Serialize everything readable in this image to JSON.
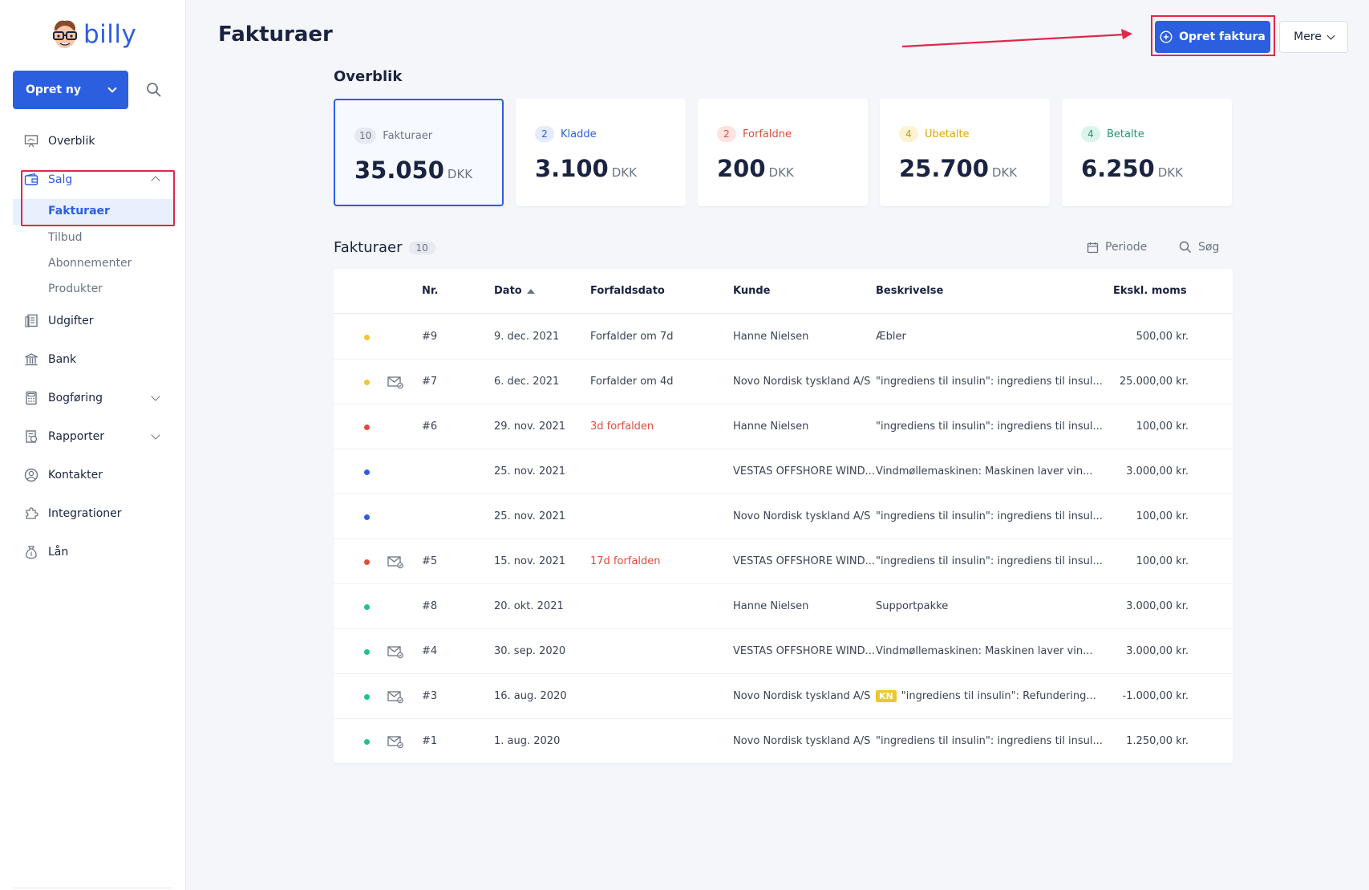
{
  "brand": {
    "name": "billy"
  },
  "sidebar": {
    "create_label": "Opret ny",
    "items": [
      {
        "label": "Overblik",
        "icon": "presentation-icon"
      },
      {
        "label": "Salg",
        "icon": "wallet-icon"
      },
      {
        "label": "Udgifter",
        "icon": "receipt-icon"
      },
      {
        "label": "Bank",
        "icon": "bank-icon"
      },
      {
        "label": "Bogføring",
        "icon": "calculator-icon"
      },
      {
        "label": "Rapporter",
        "icon": "report-icon"
      },
      {
        "label": "Kontakter",
        "icon": "user-circle-icon"
      },
      {
        "label": "Integrationer",
        "icon": "puzzle-icon"
      },
      {
        "label": "Lån",
        "icon": "money-bag-icon"
      }
    ],
    "sales_sub": [
      "Fakturaer",
      "Tilbud",
      "Abonnementer",
      "Produkter"
    ]
  },
  "header": {
    "title": "Fakturaer",
    "primary_label": "Opret faktura",
    "more_label": "Mere"
  },
  "overview": {
    "title": "Overblik",
    "cards": [
      {
        "count": "10",
        "label": "Fakturaer",
        "amount": "35.050",
        "currency": "DKK",
        "badge_bg": "#e6e9ef",
        "badge_fg": "#6b7383",
        "label_color": "#6b7383"
      },
      {
        "count": "2",
        "label": "Kladde",
        "amount": "3.100",
        "currency": "DKK",
        "badge_bg": "#e3ebfc",
        "badge_fg": "#2b5fe0",
        "label_color": "#2b5fe0"
      },
      {
        "count": "2",
        "label": "Forfaldne",
        "amount": "200",
        "currency": "DKK",
        "badge_bg": "#fde4e1",
        "badge_fg": "#e24b3b",
        "label_color": "#e24b3b"
      },
      {
        "count": "4",
        "label": "Ubetalte",
        "amount": "25.700",
        "currency": "DKK",
        "badge_bg": "#fdf3d0",
        "badge_fg": "#c9980a",
        "label_color": "#e0a800"
      },
      {
        "count": "4",
        "label": "Betalte",
        "amount": "6.250",
        "currency": "DKK",
        "badge_bg": "#dcf5ea",
        "badge_fg": "#1e9b6a",
        "label_color": "#1e9b6a"
      }
    ]
  },
  "invoices": {
    "title": "Fakturaer",
    "count": "10",
    "period_label": "Periode",
    "search_label": "Søg",
    "columns": {
      "nr": "Nr.",
      "date": "Dato",
      "due": "Forfaldsdato",
      "customer": "Kunde",
      "description": "Beskrivelse",
      "amount": "Ekskl. moms"
    },
    "rows": [
      {
        "status_color": "#f4c430",
        "mail": false,
        "nr": "#9",
        "date": "9. dec. 2021",
        "due": "Forfalder om 7d",
        "due_overdue": false,
        "customer": "Hanne Nielsen",
        "kn": "",
        "description": "Æbler",
        "amount": "500,00 kr."
      },
      {
        "status_color": "#f4c430",
        "mail": true,
        "nr": "#7",
        "date": "6. dec. 2021",
        "due": "Forfalder om 4d",
        "due_overdue": false,
        "customer": "Novo Nordisk tyskland A/S",
        "kn": "",
        "description": "\"ingrediens til insulin\": ingrediens til insul...",
        "amount": "25.000,00 kr."
      },
      {
        "status_color": "#e24b3b",
        "mail": false,
        "nr": "#6",
        "date": "29. nov. 2021",
        "due": "3d forfalden",
        "due_overdue": true,
        "customer": "Hanne Nielsen",
        "kn": "",
        "description": "\"ingrediens til insulin\": ingrediens til insul...",
        "amount": "100,00 kr."
      },
      {
        "status_color": "#2b5fe0",
        "mail": false,
        "nr": "",
        "date": "25. nov. 2021",
        "due": "",
        "due_overdue": false,
        "customer": "VESTAS OFFSHORE WIND...",
        "kn": "",
        "description": "Vindmøllemaskinen: Maskinen laver vin...",
        "amount": "3.000,00 kr."
      },
      {
        "status_color": "#2b5fe0",
        "mail": false,
        "nr": "",
        "date": "25. nov. 2021",
        "due": "",
        "due_overdue": false,
        "customer": "Novo Nordisk tyskland A/S",
        "kn": "",
        "description": "\"ingrediens til insulin\": ingrediens til insul...",
        "amount": "100,00 kr."
      },
      {
        "status_color": "#e24b3b",
        "mail": true,
        "nr": "#5",
        "date": "15. nov. 2021",
        "due": "17d forfalden",
        "due_overdue": true,
        "customer": "VESTAS OFFSHORE WIND...",
        "kn": "",
        "description": "\"ingrediens til insulin\": ingrediens til insul...",
        "amount": "100,00 kr."
      },
      {
        "status_color": "#1ec28b",
        "mail": false,
        "nr": "#8",
        "date": "20. okt. 2021",
        "due": "",
        "due_overdue": false,
        "customer": "Hanne Nielsen",
        "kn": "",
        "description": "Supportpakke",
        "amount": "3.000,00 kr."
      },
      {
        "status_color": "#1ec28b",
        "mail": true,
        "nr": "#4",
        "date": "30. sep. 2020",
        "due": "",
        "due_overdue": false,
        "customer": "VESTAS OFFSHORE WIND...",
        "kn": "",
        "description": "Vindmøllemaskinen: Maskinen laver vin...",
        "amount": "3.000,00 kr."
      },
      {
        "status_color": "#1ec28b",
        "mail": true,
        "nr": "#3",
        "date": "16. aug. 2020",
        "due": "",
        "due_overdue": false,
        "customer": "Novo Nordisk tyskland A/S",
        "kn": "KN",
        "description": "\"ingrediens til insulin\": Refundering...",
        "amount": "-1.000,00 kr."
      },
      {
        "status_color": "#1ec28b",
        "mail": true,
        "nr": "#1",
        "date": "1. aug. 2020",
        "due": "",
        "due_overdue": false,
        "customer": "Novo Nordisk tyskland A/S",
        "kn": "",
        "description": "\"ingrediens til insulin\": ingrediens til insul...",
        "amount": "1.250,00 kr."
      }
    ]
  },
  "colors": {
    "accent": "#2b5fe0",
    "highlight_box": "#e3264a"
  }
}
